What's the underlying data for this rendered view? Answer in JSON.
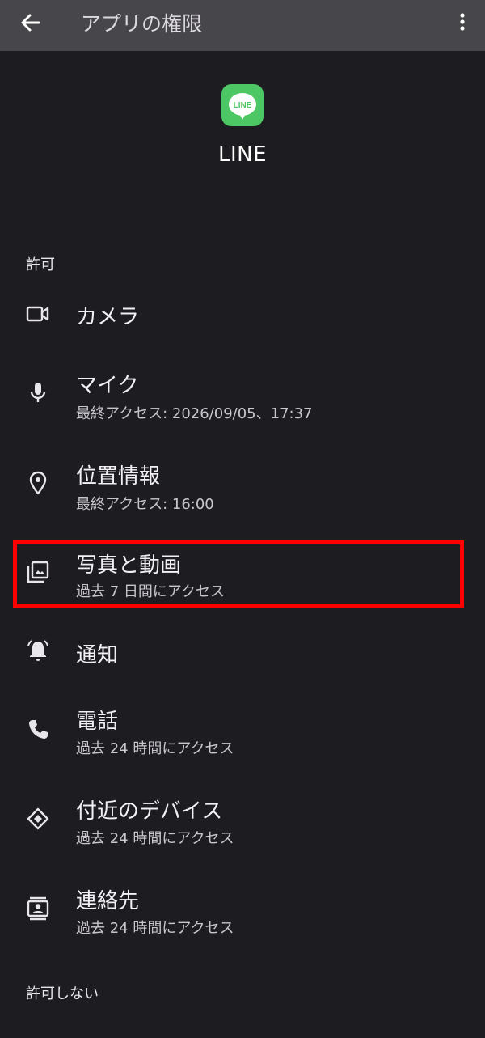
{
  "appbar": {
    "title": "アプリの権限"
  },
  "app": {
    "name": "LINE",
    "icon_text": "LINE",
    "icon_color": "#4cc764"
  },
  "sections": {
    "allowed_header": "許可",
    "denied_header": "許可しない"
  },
  "permissions": [
    {
      "title": "カメラ",
      "subtitle": "",
      "icon": "camera-icon"
    },
    {
      "title": "マイク",
      "subtitle": "最終アクセス: 2026/09/05、17:37",
      "icon": "mic-icon"
    },
    {
      "title": "位置情報",
      "subtitle": "最終アクセス: 16:00",
      "icon": "location-icon"
    },
    {
      "title": "写真と動画",
      "subtitle": "過去 7 日間にアクセス",
      "icon": "photos-icon"
    },
    {
      "title": "通知",
      "subtitle": "",
      "icon": "bell-icon"
    },
    {
      "title": "電話",
      "subtitle": "過去 24 時間にアクセス",
      "icon": "phone-icon"
    },
    {
      "title": "付近のデバイス",
      "subtitle": "過去 24 時間にアクセス",
      "icon": "nearby-devices-icon"
    },
    {
      "title": "連絡先",
      "subtitle": "過去 24 時間にアクセス",
      "icon": "contacts-icon"
    }
  ],
  "colors": {
    "highlight": "#ff0000",
    "background": "#1d1c21",
    "appbar": "#47464b"
  }
}
